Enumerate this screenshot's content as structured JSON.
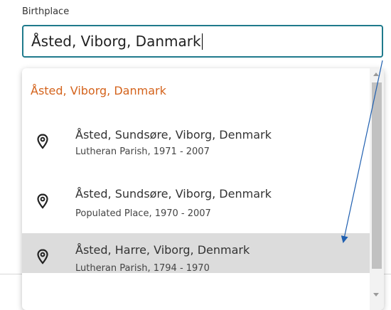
{
  "birthplace": {
    "label": "Birthplace",
    "value": "Åsted, Viborg, Danmark"
  },
  "dropdown": {
    "header": "Åsted, Viborg, Danmark",
    "options": [
      {
        "title": "Åsted, Sundsøre, Viborg, Denmark",
        "subtitle": "Lutheran Parish, 1971 - 2007",
        "icon": "location-pin-icon"
      },
      {
        "title": "Åsted, Sundsøre, Viborg, Denmark",
        "subtitle": "Populated Place, 1970 - 2007",
        "icon": "location-pin-icon"
      },
      {
        "title": "Åsted, Harre, Viborg, Denmark",
        "subtitle": "Lutheran Parish, 1794 - 1970",
        "icon": "location-pin-icon"
      }
    ],
    "highlighted_index": 2
  },
  "colors": {
    "accent_border": "#1f7a8c",
    "header_text": "#d4631c",
    "hover_bg": "#dcdcdc",
    "annotation_arrow": "#1f5fb0"
  }
}
